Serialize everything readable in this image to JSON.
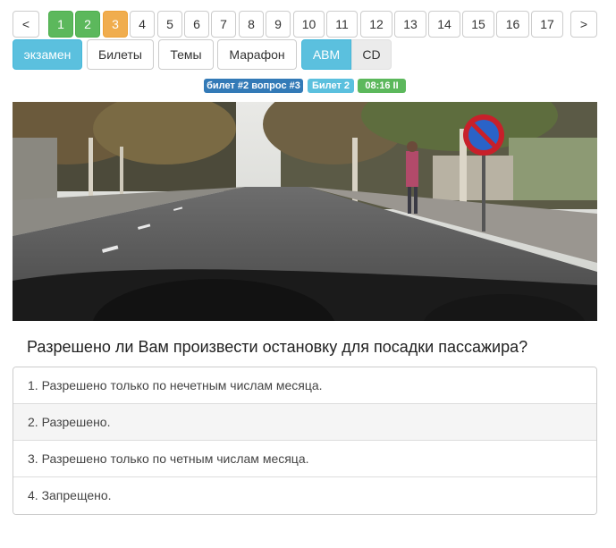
{
  "pagination": {
    "prev": "<",
    "next": ">",
    "pages": [
      "1",
      "2",
      "3",
      "4",
      "5",
      "6",
      "7",
      "8",
      "9",
      "10",
      "11",
      "12",
      "13",
      "14",
      "15",
      "16",
      "17"
    ],
    "answered_ok": [
      "1",
      "2"
    ],
    "current": "3"
  },
  "modes": {
    "exam": "экзамен",
    "tickets": "Билеты",
    "topics": "Темы",
    "marathon": "Марафон",
    "abm": "ABM",
    "cd": "CD"
  },
  "badges": {
    "ticket_question": "билет #2 вопрос #3",
    "ticket": "Билет 2",
    "timer": "08:16 II"
  },
  "question": {
    "text": "Разрешено ли Вам произвести остановку для посадки пассажира?",
    "answers": [
      "1. Разрешено только по нечетным числам месяца.",
      "2. Разрешено.",
      "3. Разрешено только по четным числам месяца.",
      "4. Запрещено."
    ]
  },
  "colors": {
    "success": "#5cb85c",
    "warning": "#f0ad4e",
    "info": "#5bc0de",
    "primary": "#337ab7"
  }
}
